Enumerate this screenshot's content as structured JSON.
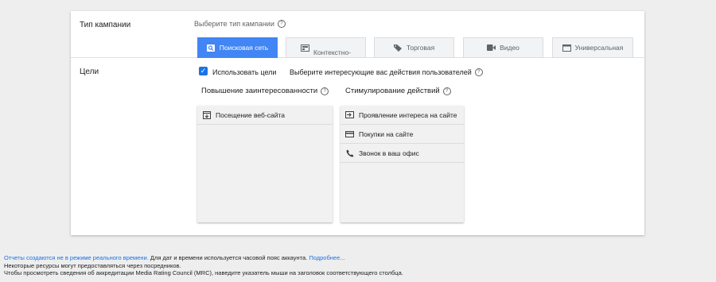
{
  "campaign_type": {
    "label": "Тип кампании",
    "hint": "Выберите тип кампании",
    "options": [
      {
        "label": "Поисковая сеть",
        "icon": "search-icon",
        "selected": true
      },
      {
        "label": "Контекстно-",
        "icon": "display-icon",
        "selected": false
      },
      {
        "label": "Торговая",
        "icon": "tag-icon",
        "selected": false
      },
      {
        "label": "Видео",
        "icon": "video-icon",
        "selected": false
      },
      {
        "label": "Универсальная",
        "icon": "app-icon",
        "selected": false
      }
    ]
  },
  "goals": {
    "label": "Цели",
    "use_goals_label": "Использовать цели",
    "use_goals_checked": true,
    "hint": "Выберите интересующие вас действия пользователей",
    "columns": [
      {
        "title": "Повышение заинтересованности",
        "items": [
          {
            "label": "Посещение веб-сайта",
            "icon": "website-icon"
          }
        ]
      },
      {
        "title": "Стимулирование действий",
        "items": [
          {
            "label": "Проявление интереса на сайте",
            "icon": "arrow-into-box-icon"
          },
          {
            "label": "Покупки на сайте",
            "icon": "credit-card-icon"
          },
          {
            "label": "Звонок в ваш офис",
            "icon": "phone-icon"
          }
        ]
      }
    ]
  },
  "footer": {
    "line1_link": "Отчеты создаются не в режиме реального времени.",
    "line1_text": " Для дат и времени используется часовой пояс аккаунта. ",
    "line1_more": "Подробнее...",
    "line2": "Некоторые ресурсы могут предоставляться через посредников.",
    "line3": "Чтобы просмотреть сведения об аккредитации Media Rating Council (MRC), наведите указатель мыши на заголовок соответствующего столбца."
  },
  "colors": {
    "accent": "#4285f4",
    "link": "#1a73e8",
    "page_bg": "#eeeeee"
  }
}
